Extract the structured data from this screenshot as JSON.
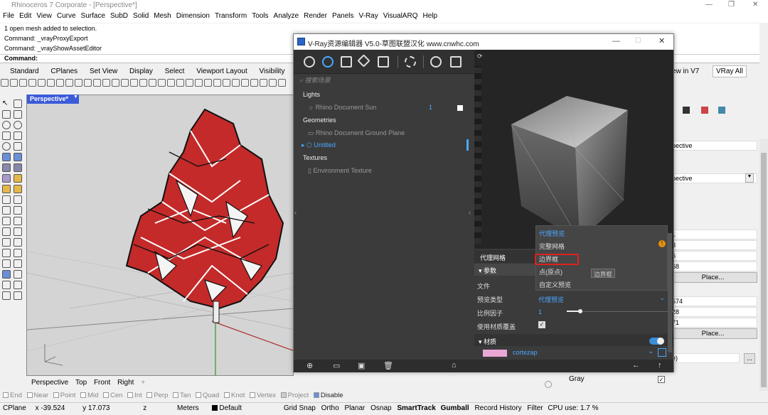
{
  "window": {
    "title": "Rhinoceros 7 Corporate - [Perspective*]"
  },
  "menu": [
    "File",
    "Edit",
    "View",
    "Curve",
    "Surface",
    "SubD",
    "Solid",
    "Mesh",
    "Dimension",
    "Transform",
    "Tools",
    "Analyze",
    "Render",
    "Panels",
    "V-Ray",
    "VisualARQ",
    "Help"
  ],
  "command_history": [
    "1 open mesh added to selection.",
    "Command: _vrayProxyExport",
    "Command: _vrayShowAssetEditor"
  ],
  "command_prompt": "Command:",
  "toolbar_tabs": [
    "Standard",
    "CPlanes",
    "Set View",
    "Display",
    "Select",
    "Viewport Layout",
    "Visibility"
  ],
  "toolbar_tabs_right": [
    "ew in V7",
    "VRay All"
  ],
  "viewport": {
    "label": "Perspective*",
    "tabs": [
      "Perspective",
      "Top",
      "Front",
      "Right"
    ],
    "add": "+"
  },
  "osnaps": [
    {
      "label": "End",
      "checked": false
    },
    {
      "label": "Near",
      "checked": false
    },
    {
      "label": "Point",
      "checked": false
    },
    {
      "label": "Mid",
      "checked": false
    },
    {
      "label": "Cen",
      "checked": false
    },
    {
      "label": "Int",
      "checked": false
    },
    {
      "label": "Perp",
      "checked": false
    },
    {
      "label": "Tan",
      "checked": false
    },
    {
      "label": "Quad",
      "checked": false
    },
    {
      "label": "Knot",
      "checked": false
    },
    {
      "label": "Vertex",
      "checked": false
    },
    {
      "label": "Project",
      "checked": false
    },
    {
      "label": "Disable",
      "checked": false
    }
  ],
  "status": {
    "cplane": "CPlane",
    "x": "x -39.524",
    "y": "y 17.073",
    "z": "z",
    "units": "Meters",
    "layer": "Default",
    "items": [
      "Grid Snap",
      "Ortho",
      "Planar",
      "Osnap",
      "SmartTrack",
      "Gumball",
      "Record History",
      "Filter",
      "CPU use: 1.7 %"
    ]
  },
  "right_panel": {
    "rows": [
      "pective",
      "pective",
      "1",
      "3",
      "6",
      "68",
      "574",
      "28",
      "71"
    ],
    "place1": "Place...",
    "place2": "Place...",
    "gray": "Gray",
    "small": "e)",
    "dots": "..."
  },
  "vray": {
    "title": "V-Ray资源编辑器 V5.0-草图联盟汉化 www.cnwhc.com",
    "search_placeholder": "搜索场景",
    "categories": {
      "lights": "Lights",
      "geometries": "Geometries",
      "textures": "Textures"
    },
    "items": {
      "sun": "Rhino Document Sun",
      "sun_count": "1",
      "ground": "Rhino Document Ground Plane",
      "untitled": "Untitled",
      "env": "Environment Texture"
    },
    "dropdown": {
      "header": "代理预览",
      "options": [
        "完整网格",
        "边界框",
        "点(原点)",
        "自定义预览"
      ],
      "tooltip": "边界框"
    },
    "props": {
      "section": "代理网格",
      "params": "参数",
      "file": "文件",
      "preview_type_label": "预览类型",
      "preview_type_value": "代理预览",
      "scale_label": "比例因子",
      "scale_value": "1",
      "use_mat_label": "使用材质覆盖",
      "materials": "材质",
      "material_name": "cortezap"
    }
  },
  "colors": {
    "accent": "#3b5bd9",
    "vray_select": "#4aa8ff",
    "highlight": "#e02020",
    "swatch": "#e9a7d6"
  }
}
